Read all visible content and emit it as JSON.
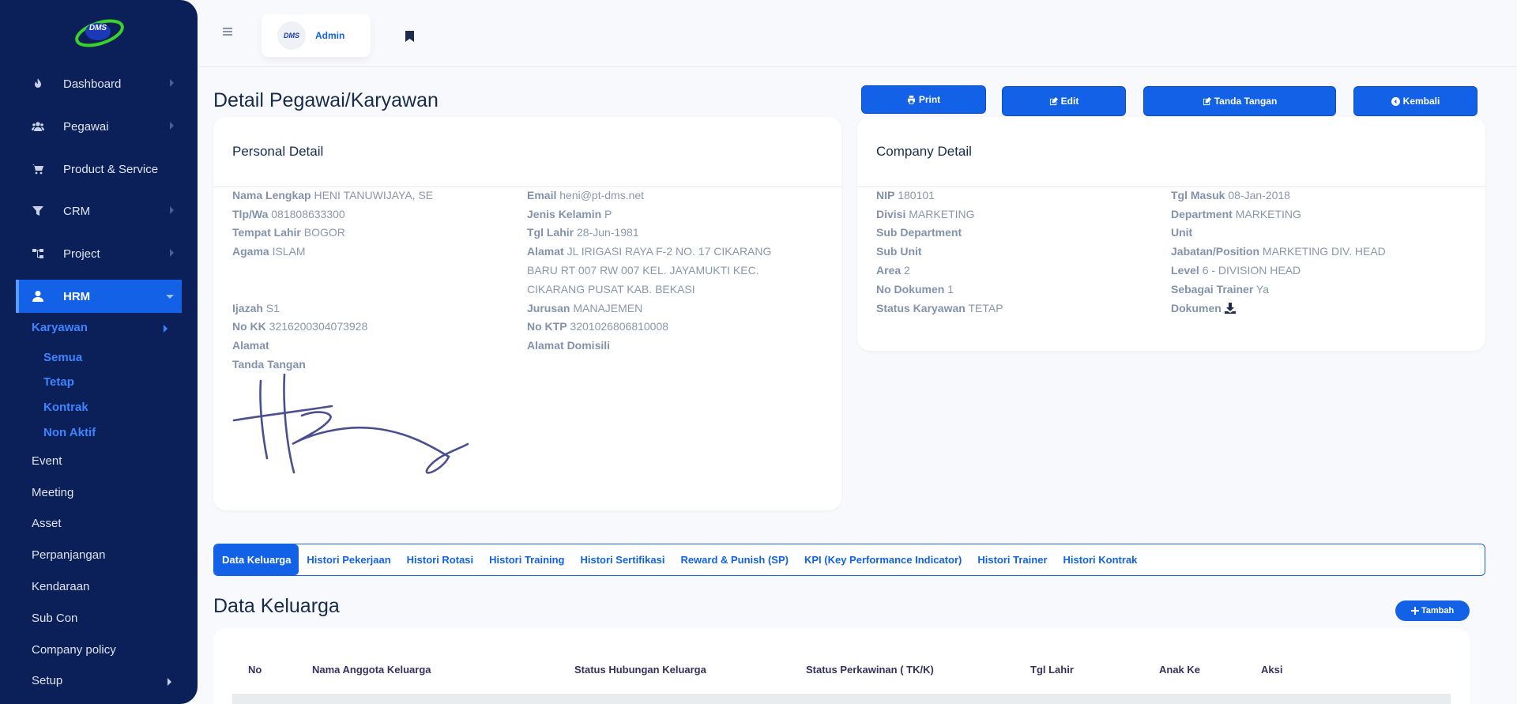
{
  "sidebar": {
    "logo_text": "DMS",
    "items": [
      {
        "label": "Dashboard",
        "icon": "fire-icon"
      },
      {
        "label": "Pegawai",
        "icon": "users-icon"
      },
      {
        "label": "Product & Service",
        "icon": "cart-icon"
      },
      {
        "label": "CRM",
        "icon": "filter-icon"
      },
      {
        "label": "Project",
        "icon": "sitemap-icon"
      },
      {
        "label": "HRM",
        "icon": "user-icon"
      }
    ],
    "submenu_head": "Karyawan",
    "submenu": [
      "Semua",
      "Tetap",
      "Kontrak",
      "Non Aktif"
    ],
    "plain": [
      "Event",
      "Meeting",
      "Asset",
      "Perpanjangan",
      "Kendaraan",
      "Sub Con",
      "Company policy",
      "Setup"
    ]
  },
  "topbar": {
    "user_name": "Admin",
    "avatar_text": "DMS"
  },
  "page": {
    "title": "Detail Pegawai/Karyawan"
  },
  "actions": {
    "print": "Print",
    "edit": "Edit",
    "sign": "Tanda Tangan",
    "back": "Kembali"
  },
  "personal": {
    "title": "Personal Detail",
    "left": [
      {
        "k": "Nama Lengkap",
        "v": "HENI TANUWIJAYA, SE"
      },
      {
        "k": "Tlp/Wa",
        "v": "081808633300"
      },
      {
        "k": "Tempat Lahir",
        "v": "BOGOR"
      },
      {
        "k": "Agama",
        "v": "ISLAM"
      },
      {
        "k": "Ijazah",
        "v": "S1"
      },
      {
        "k": "No KK",
        "v": "3216200304073928"
      },
      {
        "k": "Alamat",
        "v": ""
      },
      {
        "k": "Tanda Tangan",
        "v": ""
      }
    ],
    "right": [
      {
        "k": "Email",
        "v": "heni@pt-dms.net"
      },
      {
        "k": "Jenis Kelamin",
        "v": "P"
      },
      {
        "k": "Tgl Lahir",
        "v": "28-Jun-1981"
      },
      {
        "k": "Alamat",
        "v": "JL IRIGASI RAYA F-2 NO. 17 CIKARANG BARU RT 007 RW 007 KEL. JAYAMUKTI KEC. CIKARANG PUSAT KAB. BEKASI"
      },
      {
        "k": "Jurusan",
        "v": "MANAJEMEN"
      },
      {
        "k": "No KTP",
        "v": "3201026806810008"
      },
      {
        "k": "Alamat Domisili",
        "v": ""
      }
    ]
  },
  "company": {
    "title": "Company Detail",
    "left": [
      {
        "k": "NIP",
        "v": "180101"
      },
      {
        "k": "Divisi",
        "v": "MARKETING"
      },
      {
        "k": "Sub Department",
        "v": ""
      },
      {
        "k": "Sub Unit",
        "v": ""
      },
      {
        "k": "Area",
        "v": "2"
      },
      {
        "k": "No Dokumen",
        "v": "1"
      },
      {
        "k": "Status Karyawan",
        "v": "TETAP"
      }
    ],
    "right": [
      {
        "k": "Tgl Masuk",
        "v": "08-Jan-2018"
      },
      {
        "k": "Department",
        "v": "MARKETING"
      },
      {
        "k": "Unit",
        "v": ""
      },
      {
        "k": "Jabatan/Position",
        "v": "MARKETING DIV. HEAD"
      },
      {
        "k": "Level",
        "v": "6 - DIVISION HEAD"
      },
      {
        "k": "Sebagai Trainer",
        "v": "Ya"
      },
      {
        "k": "Dokumen",
        "v": ""
      }
    ]
  },
  "tabs": [
    "Data Keluarga",
    "Histori Pekerjaan",
    "Histori Rotasi",
    "Histori Training",
    "Histori Sertifikasi",
    "Reward & Punish (SP)",
    "KPI (Key Performance Indicator)",
    "Histori Trainer",
    "Histori Kontrak"
  ],
  "family": {
    "title": "Data Keluarga",
    "add_label": "Tambah",
    "columns": [
      "No",
      "Nama Anggota Keluarga",
      "Status Hubungan Keluarga",
      "Status Perkawinan ( TK/K)",
      "Tgl Lahir",
      "Anak Ke",
      "Aksi"
    ]
  }
}
